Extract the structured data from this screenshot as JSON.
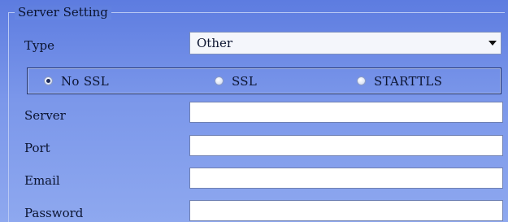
{
  "group": {
    "title": "Server Setting"
  },
  "type": {
    "label": "Type",
    "selected": "Other"
  },
  "security": {
    "options": [
      {
        "label": "No SSL",
        "checked": true
      },
      {
        "label": "SSL",
        "checked": false
      },
      {
        "label": "STARTTLS",
        "checked": false
      }
    ]
  },
  "fields": {
    "server": {
      "label": "Server",
      "value": ""
    },
    "port": {
      "label": "Port",
      "value": ""
    },
    "email": {
      "label": "Email",
      "value": ""
    },
    "password": {
      "label": "Password",
      "value": ""
    }
  }
}
